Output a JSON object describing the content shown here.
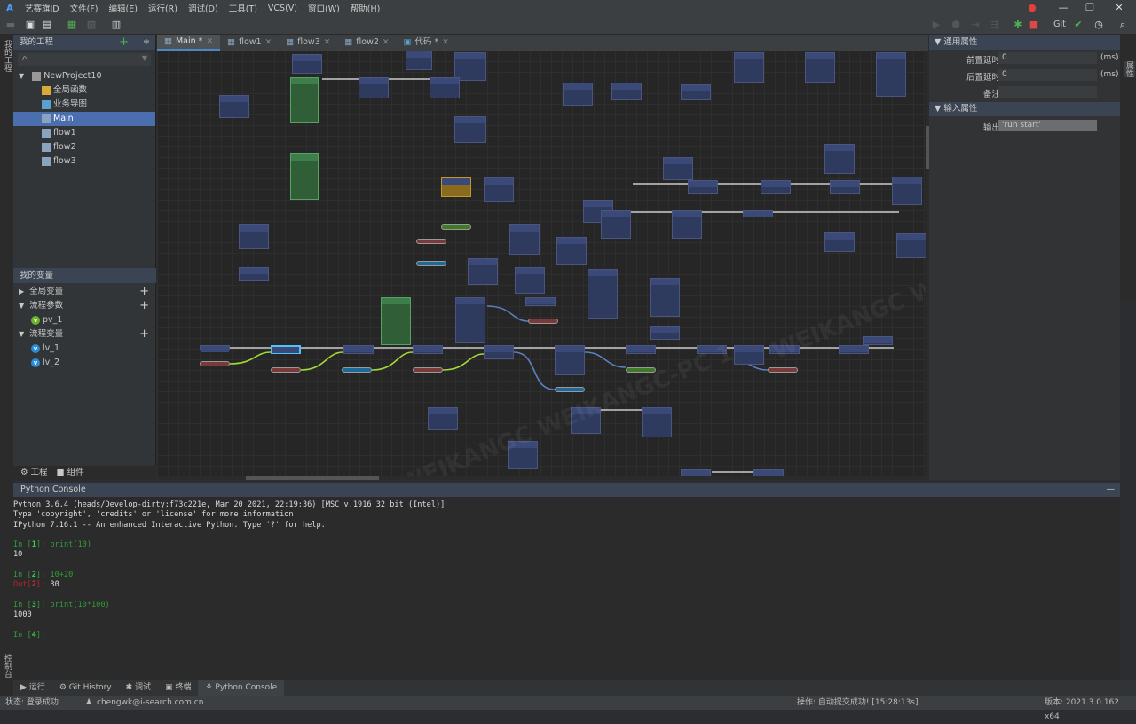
{
  "app": {
    "title": "艺赛旗ID",
    "accent": "#4b6eaf"
  },
  "menu": [
    "文件(F)",
    "编辑(E)",
    "运行(R)",
    "调试(D)",
    "工具(T)",
    "VCS(V)",
    "窗口(W)",
    "帮助(H)"
  ],
  "toolbar": {
    "git_label": "Git"
  },
  "activity": {
    "project_label": "我的工程",
    "console_label": "控制台"
  },
  "project_panel": {
    "title": "我的工程",
    "search_placeholder": "",
    "root": "NewProject10",
    "items": [
      {
        "label": "全局函数",
        "icon": "function-icon"
      },
      {
        "label": "业务导图",
        "icon": "mindmap-icon"
      },
      {
        "label": "Main",
        "icon": "flow-icon",
        "selected": true
      },
      {
        "label": "flow1",
        "icon": "flow-icon"
      },
      {
        "label": "flow2",
        "icon": "flow-icon"
      },
      {
        "label": "flow3",
        "icon": "flow-icon"
      }
    ]
  },
  "variables_panel": {
    "title": "我的变量",
    "groups": [
      {
        "label": "全局变量",
        "expanded": false,
        "vars": []
      },
      {
        "label": "流程参数",
        "expanded": true,
        "vars": [
          "pv_1"
        ]
      },
      {
        "label": "流程变量",
        "expanded": true,
        "vars": [
          "lv_1",
          "lv_2"
        ]
      }
    ]
  },
  "left_tabs": [
    "工程",
    "组件"
  ],
  "tabs": [
    {
      "label": "Main *",
      "active": true,
      "icon": "flow-icon"
    },
    {
      "label": "flow1",
      "icon": "flow-icon"
    },
    {
      "label": "flow3",
      "icon": "flow-icon"
    },
    {
      "label": "flow2",
      "icon": "flow-icon"
    },
    {
      "label": "代码 *",
      "icon": "code-icon"
    }
  ],
  "canvas": {
    "watermark": "WEIKANGC WEIKANGC-PC 1"
  },
  "properties": {
    "strip_label": "属性",
    "general": {
      "title": "通用属性",
      "rows": [
        {
          "label": "前置延时",
          "value": "0",
          "unit": "(ms)"
        },
        {
          "label": "后置延时",
          "value": "0",
          "unit": "(ms)"
        },
        {
          "label": "备注",
          "value": ""
        }
      ]
    },
    "input": {
      "title": "输入属性",
      "rows": [
        {
          "label": "输出",
          "value": "'run start'"
        }
      ]
    }
  },
  "console": {
    "title": "Python Console",
    "banner": [
      "Python 3.6.4 (heads/Develop-dirty:f73c221e, Mar 20 2021, 22:19:36) [MSC v.1916 32 bit (Intel)]",
      "Type 'copyright', 'credits' or 'license' for more information",
      "IPython 7.16.1 -- An enhanced Interactive Python. Type '?' for help."
    ],
    "cells": [
      {
        "n": "1",
        "input": "print(10)",
        "output": "10"
      },
      {
        "n": "2",
        "input": "10+20",
        "out": "30"
      },
      {
        "n": "3",
        "input": "print(10*100)",
        "output": "1000"
      },
      {
        "n": "4",
        "input": ""
      }
    ]
  },
  "bottom_tabs": [
    {
      "label": "运行"
    },
    {
      "label": "Git History"
    },
    {
      "label": "调试"
    },
    {
      "label": "终端"
    },
    {
      "label": "Python Console",
      "active": true
    }
  ],
  "status": {
    "state": "状态: 登录成功",
    "user": "chengwk@i-search.com.cn",
    "operation": "操作: 自动提交成功! [15:28:13s]",
    "version": "版本: 2021.3.0.162 x64"
  }
}
